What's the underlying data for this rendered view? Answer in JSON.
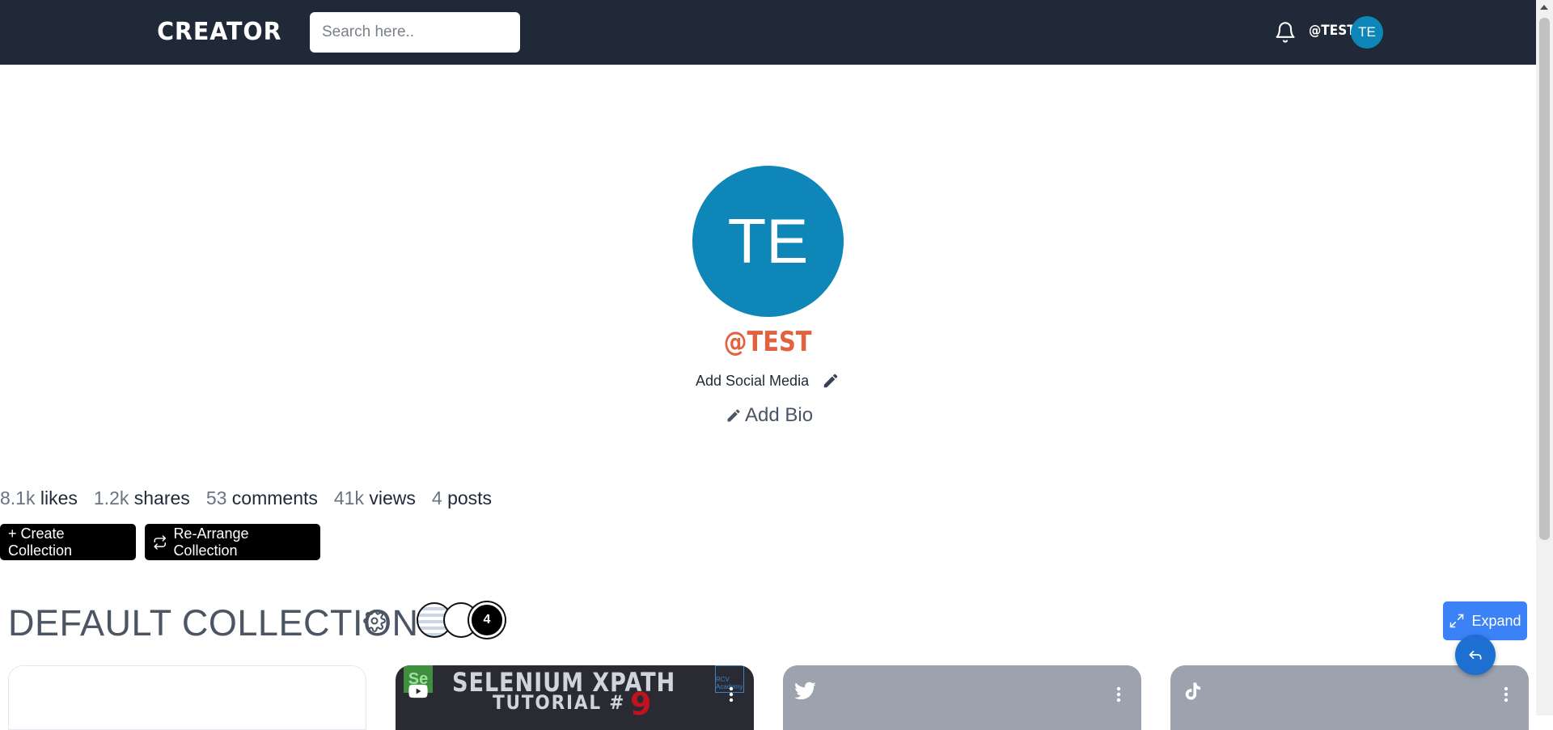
{
  "navbar": {
    "logo": "CREATOR",
    "search_placeholder": "Search here..",
    "username": "@TEST",
    "avatar_initials": "TE",
    "bell_icon": "bell-icon"
  },
  "profile": {
    "avatar_initials": "TE",
    "handle": "@TEST",
    "add_social_label": "Add Social Media",
    "add_bio_label": "Add Bio",
    "accent_color": "#e2623f",
    "avatar_color": "#0e87b8"
  },
  "stats": [
    {
      "value": "8.1k",
      "label": "likes"
    },
    {
      "value": "1.2k",
      "label": "shares"
    },
    {
      "value": "53",
      "label": "comments"
    },
    {
      "value": "41k",
      "label": "views"
    },
    {
      "value": "4",
      "label": "posts"
    }
  ],
  "actions": {
    "create_label": "+ Create Collection",
    "rearrange_label": "Re-Arrange Collection"
  },
  "collection": {
    "title": "DEFAULT COLLECTION",
    "member_count": "4",
    "expand_label": "Expand"
  },
  "cards": [
    {
      "type": "empty"
    },
    {
      "type": "youtube",
      "title": "SELENIUM XPATH",
      "subtitle": "TUTORIAL #",
      "number": "9",
      "badge": "Se",
      "brand": "RCV Academy",
      "icon": "youtube-icon"
    },
    {
      "type": "twitter",
      "icon": "twitter-icon"
    },
    {
      "type": "tiktok",
      "icon": "tiktok-icon"
    }
  ]
}
